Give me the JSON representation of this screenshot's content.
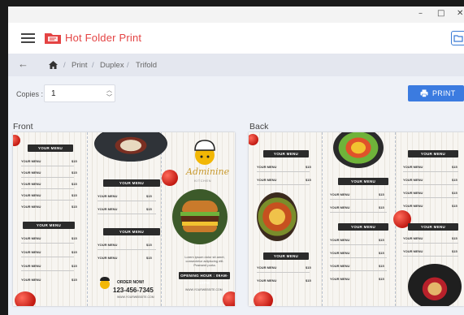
{
  "window": {
    "minimize_glyph": "–",
    "maximize_glyph": "□",
    "close_glyph": "✕"
  },
  "app": {
    "title": "Hot Folder Print",
    "accent_color": "#e44343"
  },
  "breadcrumb": {
    "items": [
      "Print",
      "Duplex",
      "Trifold"
    ],
    "separator": "/"
  },
  "copies": {
    "label": "Copies :",
    "value": "1"
  },
  "print_button": {
    "label": "PRINT"
  },
  "front": {
    "label": "Front",
    "menu_tag": "YOUR MENU",
    "item_label": "YOUR MENU",
    "price": "$15",
    "brand_name": "Adminine",
    "brand_sub": "KITCHEN",
    "order_now": "ORDER NOW!",
    "phone": "123-456-7345",
    "hours": "OPENING HOUR : 09AM-10PM",
    "website": "WWW.YOURWEBSITE.COM",
    "tagline": "Lorem ipsum dolor sit amet, consectetur adipiscing elit. Praesent porta."
  },
  "back": {
    "label": "Back",
    "menu_tag": "YOUR MENU",
    "item_label": "YOUR MENU",
    "price": "$15"
  },
  "icons": [
    "hamburger-menu-icon",
    "app-logo-icon",
    "folder-icon",
    "back-arrow-icon",
    "home-icon",
    "printer-icon",
    "chevron-up-icon",
    "chevron-down-icon"
  ]
}
